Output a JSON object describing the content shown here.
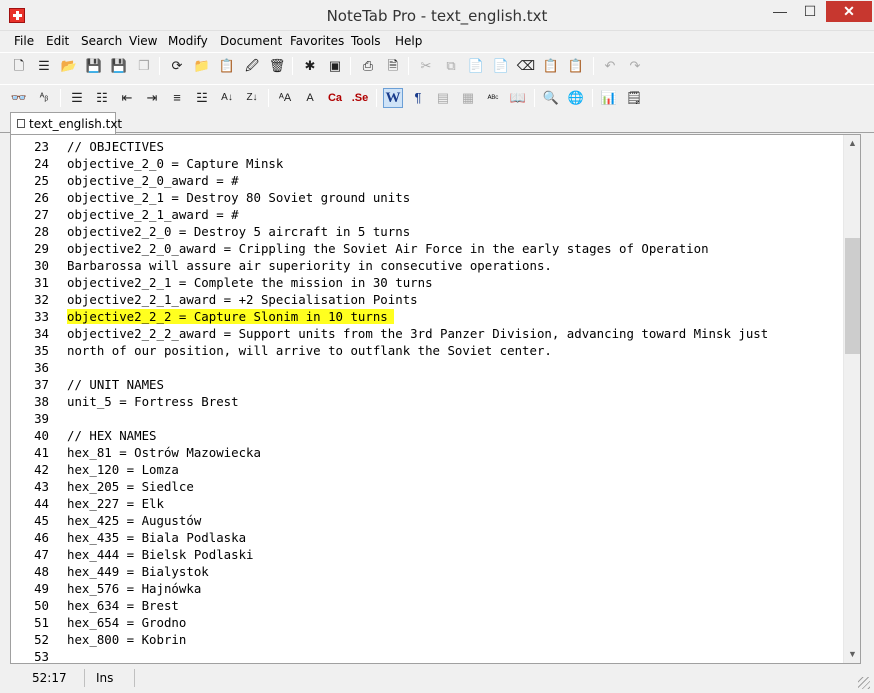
{
  "window": {
    "title": "NoteTab Pro  -  text_english.txt",
    "min_label": "—",
    "max_label": "☐",
    "close_label": "✕"
  },
  "menu": [
    "File",
    "Edit",
    "Search",
    "View",
    "Modify",
    "Document",
    "Favorites",
    "Tools",
    "Help"
  ],
  "toolbar1": [
    {
      "name": "new-document-icon",
      "glyph": "🗋"
    },
    {
      "name": "new-outline-icon",
      "glyph": "☰"
    },
    {
      "name": "open-folder-icon",
      "glyph": "📂"
    },
    {
      "name": "save-icon",
      "glyph": "💾"
    },
    {
      "name": "save-as-icon",
      "glyph": "💾"
    },
    {
      "name": "save-all-icon",
      "glyph": "❐"
    },
    {
      "name": "reload-icon",
      "glyph": "⟳"
    },
    {
      "name": "open-favorites-icon",
      "glyph": "📁"
    },
    {
      "name": "clipbook-icon",
      "glyph": "📋"
    },
    {
      "name": "file-properties-icon",
      "glyph": "🖉"
    },
    {
      "name": "delete-icon",
      "glyph": "🗑"
    },
    {
      "name": "insert-date-icon",
      "glyph": "✱"
    },
    {
      "name": "insert-file-icon",
      "glyph": "▣"
    },
    {
      "name": "print-icon",
      "glyph": "⎙"
    },
    {
      "name": "print-preview-icon",
      "glyph": "🗎"
    },
    {
      "name": "cut-icon",
      "glyph": "✂"
    },
    {
      "name": "copy-icon",
      "glyph": "⧉"
    },
    {
      "name": "paste-icon",
      "glyph": "📄"
    },
    {
      "name": "paste-special-icon",
      "glyph": "📄"
    },
    {
      "name": "eraser-icon",
      "glyph": "⌫"
    },
    {
      "name": "clipboard-icon",
      "glyph": "📋"
    },
    {
      "name": "clipboard-append-icon",
      "glyph": "📋"
    },
    {
      "name": "undo-icon",
      "glyph": "↶"
    },
    {
      "name": "redo-icon",
      "glyph": "↷"
    }
  ],
  "toolbar2": [
    {
      "name": "find-icon",
      "glyph": "👓"
    },
    {
      "name": "spell-replace-icon",
      "glyph": "ᴬᵦ"
    },
    {
      "name": "bullet-list-icon",
      "glyph": "☰"
    },
    {
      "name": "numbered-list-icon",
      "glyph": "☷"
    },
    {
      "name": "outdent-icon",
      "glyph": "⇤"
    },
    {
      "name": "indent-icon",
      "glyph": "⇥"
    },
    {
      "name": "align-icon",
      "glyph": "≡"
    },
    {
      "name": "justify-icon",
      "glyph": "☳"
    },
    {
      "name": "sort-ascending-icon",
      "glyph": "A↓"
    },
    {
      "name": "sort-descending-icon",
      "glyph": "Z↓"
    },
    {
      "name": "font-size-icon",
      "glyph": "ᴬA"
    },
    {
      "name": "uppercase-icon",
      "glyph": "A"
    },
    {
      "name": "capitalize-icon",
      "glyph": "Ca"
    },
    {
      "name": "sentence-case-icon",
      "glyph": ".Se"
    },
    {
      "name": "word-wrap-icon",
      "glyph": "W"
    },
    {
      "name": "paragraph-marks-icon",
      "glyph": "¶"
    },
    {
      "name": "ruler-icon",
      "glyph": "▤"
    },
    {
      "name": "calculate-icon",
      "glyph": "▦"
    },
    {
      "name": "spell-check-icon",
      "glyph": "ᴬᴮᶜ"
    },
    {
      "name": "thesaurus-icon",
      "glyph": "📖"
    },
    {
      "name": "web-search-icon",
      "glyph": "🔍"
    },
    {
      "name": "browser-view-icon",
      "glyph": "🌐"
    },
    {
      "name": "statistics-icon",
      "glyph": "📊"
    },
    {
      "name": "document-info-icon",
      "glyph": "🗒"
    }
  ],
  "tab": {
    "label": "text_english.txt"
  },
  "editor": {
    "lines": [
      {
        "n": "23",
        "text": "// OBJECTIVES"
      },
      {
        "n": "24",
        "text": "objective_2_0 = Capture Minsk"
      },
      {
        "n": "25",
        "text": "objective_2_0_award = #"
      },
      {
        "n": "26",
        "text": "objective_2_1 = Destroy 80 Soviet ground units"
      },
      {
        "n": "27",
        "text": "objective_2_1_award = #"
      },
      {
        "n": "28",
        "text": "objective2_2_0 = Destroy 5 aircraft in 5 turns"
      },
      {
        "n": "29",
        "text": "objective2_2_0_award = Crippling the Soviet Air Force in the early stages of Operation"
      },
      {
        "n": "30",
        "text": "Barbarossa will assure air superiority in consecutive operations."
      },
      {
        "n": "31",
        "text": "objective2_2_1 = Complete the mission in 30 turns"
      },
      {
        "n": "32",
        "text": "objective2_2_1_award = +2 Specialisation Points"
      },
      {
        "n": "33",
        "text": "objective2_2_2 = Capture Slonim in 10 turns",
        "highlight": true
      },
      {
        "n": "34",
        "text": "objective2_2_2_award = Support units from the 3rd Panzer Division, advancing toward Minsk just"
      },
      {
        "n": "35",
        "text": "north of our position, will arrive to outflank the Soviet center."
      },
      {
        "n": "36",
        "text": ""
      },
      {
        "n": "37",
        "text": "// UNIT NAMES"
      },
      {
        "n": "38",
        "text": "unit_5 = Fortress Brest"
      },
      {
        "n": "39",
        "text": ""
      },
      {
        "n": "40",
        "text": "// HEX NAMES"
      },
      {
        "n": "41",
        "text": "hex_81 = Ostrów Mazowiecka"
      },
      {
        "n": "42",
        "text": "hex_120 = Lomza"
      },
      {
        "n": "43",
        "text": "hex_205 = Siedlce"
      },
      {
        "n": "44",
        "text": "hex_227 = Elk"
      },
      {
        "n": "45",
        "text": "hex_425 = Augustów"
      },
      {
        "n": "46",
        "text": "hex_435 = Biala Podlaska"
      },
      {
        "n": "47",
        "text": "hex_444 = Bielsk Podlaski"
      },
      {
        "n": "48",
        "text": "hex_449 = Bialystok"
      },
      {
        "n": "49",
        "text": "hex_576 = Hajnówka"
      },
      {
        "n": "50",
        "text": "hex_634 = Brest"
      },
      {
        "n": "51",
        "text": "hex_654 = Grodno"
      },
      {
        "n": "52",
        "text": "hex_800 = Kobrin"
      },
      {
        "n": "53",
        "text": ""
      }
    ],
    "highlight_color": "#ffff1f",
    "scroll": {
      "up_arrow": "▲",
      "down_arrow": "▼"
    }
  },
  "status": {
    "position": "52:17",
    "mode": "Ins"
  }
}
